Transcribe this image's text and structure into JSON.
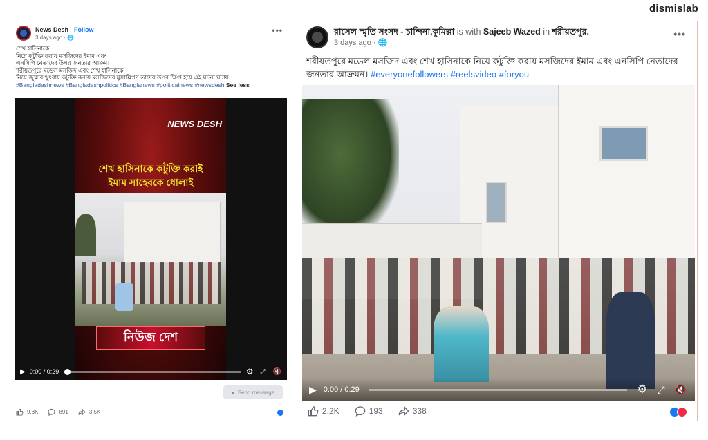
{
  "brand": "dismislab",
  "left_post": {
    "page_name": "News Desh",
    "follow_label": "Follow",
    "time": "3 days ago · ",
    "body_lines": [
      "শেখ হাসিনাকে",
      "নিয়ে কটুক্তি করায় মসজিদের ইমাম এবং",
      "এনসিপি নেতাদের উপর জনতার আক্রম।",
      "শরীয়তপুরে মডেল মসজিদ এবং শেখ হাসিনাকে",
      "নিয়ে জুম্মার খুৎবায় কটুক্তি করায় মসজিদের মুসাল্লিগণ তাদের উপর ক্ষিপ্ত হয়ে এই ঘটনা ঘটায়।"
    ],
    "hashtags": "#Bangladeshnews #Bangladeshpolitics #Banglanews #politicalnews #newsdesh",
    "see_less": "See less",
    "video": {
      "logo": "NEWS DESH",
      "headline_1": "শেখ হাসিনাকে কটুক্তি করাই",
      "headline_2": "ইমাম সাহেবকে ধোলাই",
      "bottom_label": "নিউজ দেশ",
      "time": "0:00 / 0:29"
    },
    "send_message": "Send message",
    "reactions": "9.8K",
    "comments": "891",
    "shares": "3.5K"
  },
  "right_post": {
    "page_name": "রাসেল স্মৃতি সংসদ - চান্দিনা,কুমিল্লা",
    "with_text": " is with ",
    "with_name": "Sajeeb Wazed",
    "in_text": " in ",
    "location": "শরীয়তপুর.",
    "time": "3 days ago · ",
    "body": "শরীয়তপুরে মডেল মসজিদ এবং শেখ হাসিনাকে নিয়ে কটুক্তি করায় মসজিদের ইমাম এবং এনসিপি নেতাদের জনতার আক্রমন।",
    "hashtags": "#everyonefollowers #reelsvideo #foryou",
    "video_time": "0:00 / 0:29",
    "reactions": "2.2K",
    "comments": "193",
    "shares": "338"
  },
  "colors": {
    "border": "#e8b9b2",
    "link": "#1877f2",
    "hashtag": "#385898",
    "news_red": "#c8102e",
    "headline_yellow": "#f4e12a"
  }
}
